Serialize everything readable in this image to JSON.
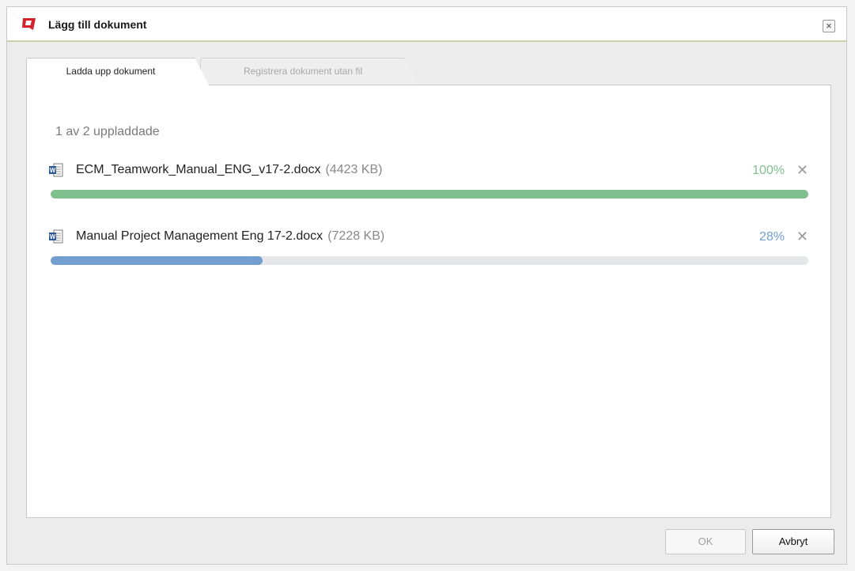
{
  "dialog": {
    "title": "Lägg till dokument",
    "close_label": "×"
  },
  "tabs": [
    {
      "label": "Ladda upp dokument",
      "active": true
    },
    {
      "label": "Registrera dokument utan fil",
      "active": false
    }
  ],
  "upload": {
    "status": "1 av 2 uppladdade",
    "files": [
      {
        "name": "ECM_Teamwork_Manual_ENG_v17-2.docx",
        "size": "(4423 KB)",
        "percent": "100%",
        "progress": 1.0,
        "color": "#7fbf8e",
        "icon": "word-document-icon"
      },
      {
        "name": "Manual Project Management Eng 17-2.docx",
        "size": "(7228 KB)",
        "percent": "28%",
        "progress": 0.28,
        "color": "#739fd0",
        "icon": "word-document-icon"
      }
    ],
    "remove_glyph": "✕"
  },
  "buttons": {
    "ok": "OK",
    "cancel": "Avbryt"
  },
  "colors": {
    "brand_red": "#d3222a",
    "title_underline": "#c9d3a8"
  }
}
